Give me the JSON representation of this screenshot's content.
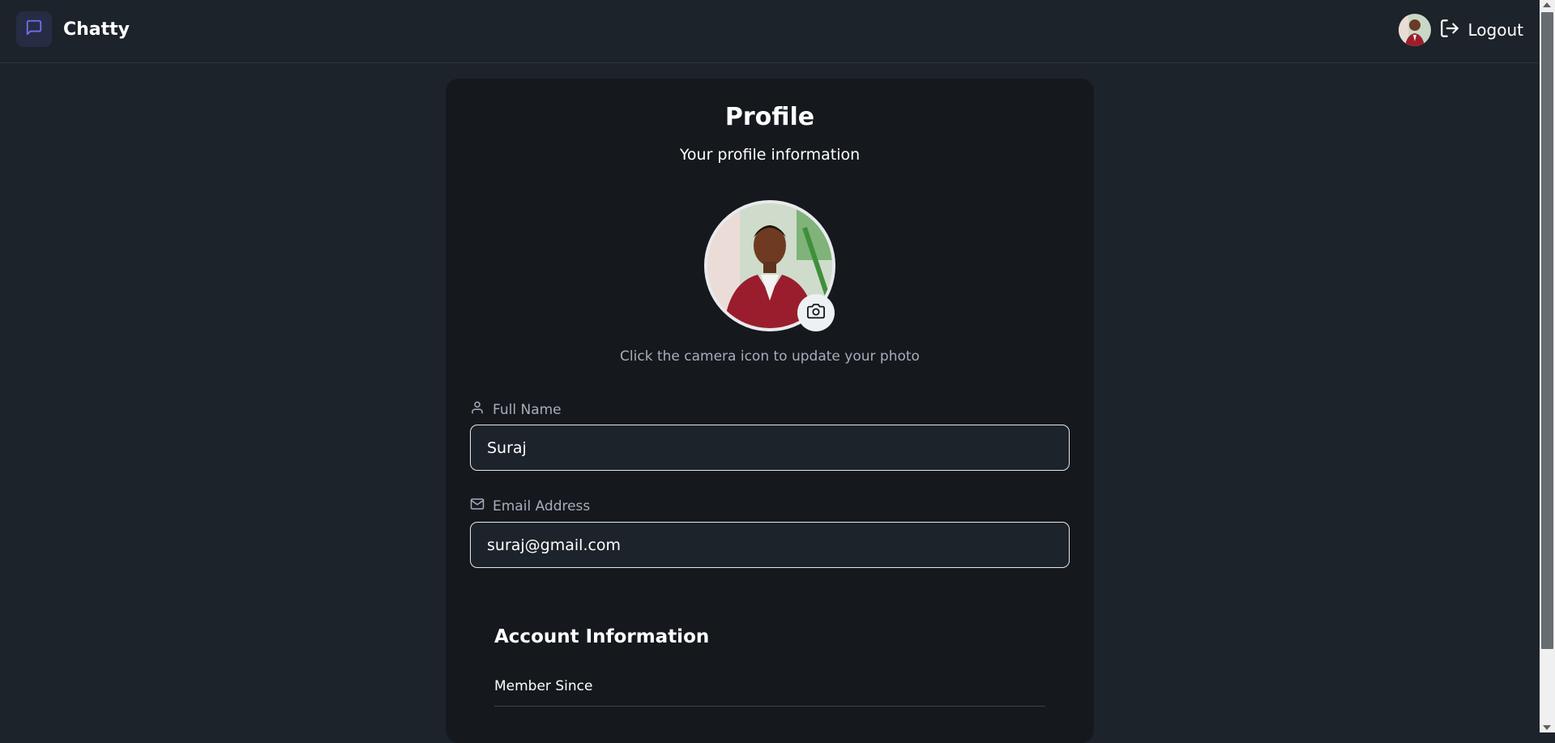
{
  "app": {
    "name": "Chatty",
    "accent_color": "#6366f1"
  },
  "nav": {
    "logout_label": "Logout",
    "logout_icon": "logout-icon",
    "logo_icon": "message-square-icon"
  },
  "profile": {
    "title": "Profile",
    "subtitle": "Your profile information",
    "avatar_alt": "profile photo",
    "camera_icon": "camera-icon",
    "hint": "Click the camera icon to update your photo",
    "full_name": {
      "label": "Full Name",
      "icon": "user-icon",
      "value": "Suraj"
    },
    "email": {
      "label": "Email Address",
      "icon": "mail-icon",
      "value": "suraj@gmail.com"
    }
  },
  "account": {
    "title": "Account Information",
    "member_since_label": "Member Since"
  }
}
